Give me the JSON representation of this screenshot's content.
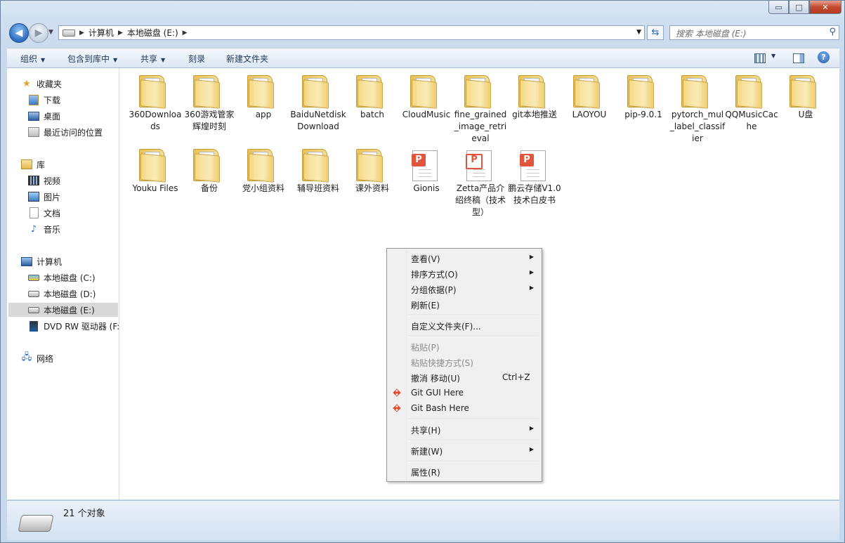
{
  "window": {
    "caption_min": "▭",
    "caption_max": "□",
    "caption_close": "✕"
  },
  "address": {
    "segments": [
      "计算机",
      "本地磁盘 (E:)"
    ]
  },
  "search": {
    "placeholder": "搜索 本地磁盘 (E:)"
  },
  "toolbar": {
    "organize": "组织",
    "include_library": "包含到库中",
    "share": "共享",
    "burn": "刻录",
    "new_folder": "新建文件夹",
    "help": "?"
  },
  "nav": {
    "favorites": "收藏夹",
    "downloads": "下载",
    "desktop": "桌面",
    "recent": "最近访问的位置",
    "libraries": "库",
    "videos": "视频",
    "pictures": "图片",
    "documents": "文档",
    "music": "音乐",
    "computer": "计算机",
    "drive_c": "本地磁盘 (C:)",
    "drive_d": "本地磁盘 (D:)",
    "drive_e": "本地磁盘 (E:)",
    "dvd": "DVD RW 驱动器 (F:",
    "network": "网络"
  },
  "items": [
    {
      "name": "360Downloads",
      "type": "folder"
    },
    {
      "name": "360游戏管家辉煌时刻",
      "type": "folder"
    },
    {
      "name": "app",
      "type": "folder"
    },
    {
      "name": "BaiduNetdiskDownload",
      "type": "folder"
    },
    {
      "name": "batch",
      "type": "folder"
    },
    {
      "name": "CloudMusic",
      "type": "folder"
    },
    {
      "name": "fine_grained_image_retrieval",
      "type": "folder"
    },
    {
      "name": "git本地推送",
      "type": "folder"
    },
    {
      "name": "LAOYOU",
      "type": "folder"
    },
    {
      "name": "pip-9.0.1",
      "type": "folder"
    },
    {
      "name": "pytorch_mul_label_classifier",
      "type": "folder"
    },
    {
      "name": "QQMusicCache",
      "type": "folder"
    },
    {
      "name": "U盘",
      "type": "folder"
    },
    {
      "name": "Youku Files",
      "type": "folder"
    },
    {
      "name": "备份",
      "type": "folder"
    },
    {
      "name": "党小组资料",
      "type": "folder"
    },
    {
      "name": "辅导班资料",
      "type": "folder"
    },
    {
      "name": "课外资料",
      "type": "folder"
    },
    {
      "name": "Gionis",
      "type": "pdf"
    },
    {
      "name": "Zetta产品介绍终稿（技术型）",
      "type": "pdf"
    },
    {
      "name": "鹏云存储V1.0技术白皮书",
      "type": "pdf"
    }
  ],
  "context_menu": {
    "view": "查看(V)",
    "sort": "排序方式(O)",
    "group": "分组依据(P)",
    "refresh": "刷新(E)",
    "customize": "自定义文件夹(F)...",
    "paste": "粘贴(P)",
    "paste_shortcut": "粘贴快捷方式(S)",
    "undo": "撤消 移动(U)",
    "undo_shortcut": "Ctrl+Z",
    "git_gui": "Git GUI Here",
    "git_bash": "Git Bash Here",
    "share": "共享(H)",
    "new": "新建(W)",
    "properties": "属性(R)"
  },
  "status": {
    "count": "21 个对象"
  }
}
